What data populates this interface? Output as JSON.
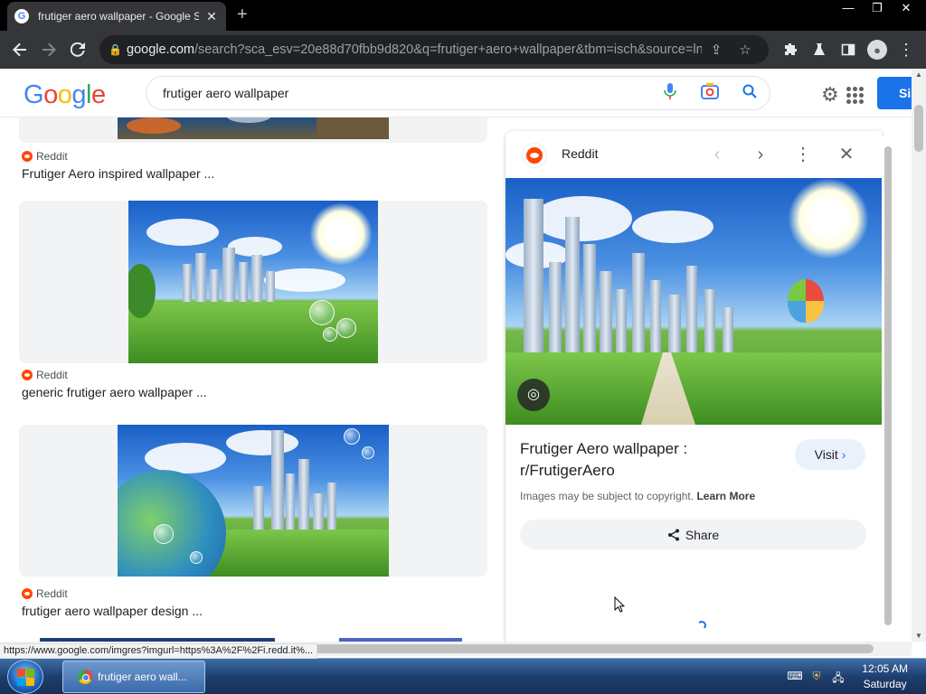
{
  "browser": {
    "tab_title": "frutiger aero wallpaper - Google Search",
    "tab_favicon_letter": "G",
    "url_main": "google.com",
    "url_rest": "/search?sca_esv=20e88d70fbb9d820&q=frutiger+aero+wallpaper&tbm=isch&source=ln...",
    "window_controls": [
      "—",
      "❐",
      "✕"
    ]
  },
  "search": {
    "query": "frutiger aero wallpaper",
    "signin_label": "Si"
  },
  "results": [
    {
      "source": "Reddit",
      "title": "Frutiger Aero inspired wallpaper ..."
    },
    {
      "source": "Reddit",
      "title": "generic frutiger aero wallpaper ..."
    },
    {
      "source": "Reddit",
      "title": "frutiger aero wallpaper design ..."
    }
  ],
  "panel": {
    "site": "Reddit",
    "title": "Frutiger Aero wallpaper : r/FrutigerAero",
    "visit_label": "Visit",
    "copyright_text": "Images may be subject to copyright.",
    "learn_more": "Learn More",
    "share_label": "Share"
  },
  "status_bar_url": "https://www.google.com/imgres?imgurl=https%3A%2F%2Fi.redd.it%...",
  "taskbar": {
    "window_label": "frutiger aero wall...",
    "time": "12:05 AM",
    "day": "Saturday"
  },
  "colors": {
    "google_blue": "#4285f4",
    "google_red": "#ea4335",
    "google_yellow": "#fbbc05",
    "google_green": "#34a853",
    "reddit_orange": "#ff4500",
    "signin_blue": "#1a73e8"
  }
}
